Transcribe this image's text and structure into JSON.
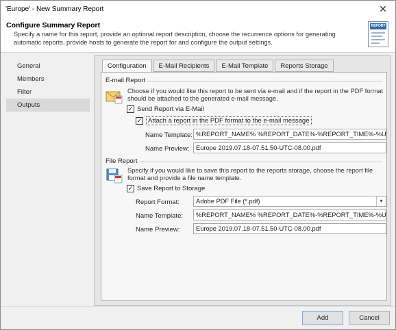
{
  "window": {
    "title": "'Europe' - New Summary Report",
    "close_glyph": "✕"
  },
  "header": {
    "title": "Configure Summary Report",
    "description": "Specify a name for this report, provide an optional report description, choose the recurrence options for generating automatic reports, provide hosts to generate the report for and configure the output settings.",
    "icon_label": "REPORT"
  },
  "nav": {
    "items": [
      "General",
      "Members",
      "Filter",
      "Outputs"
    ],
    "selected": "Outputs"
  },
  "tabs": [
    "Configuration",
    "E-Mail Recipients",
    "E-Mail Template",
    "Reports Storage"
  ],
  "email": {
    "section": "E-mail Report",
    "hint": "Choose if you would like this report to be sent via e-mail and if the report in the PDF format should be attached to the generated e-mail message.",
    "send_label": "Send Report via E-Mail",
    "attach_label": "Attach a report in the PDF format to the e-mail message",
    "name_template_label": "Name Template:",
    "name_template_value": "%REPORT_NAME% %REPORT_DATE%-%REPORT_TIME%-%UTC_O",
    "name_preview_label": "Name Preview:",
    "name_preview_value": "Europe 2019.07.18-07.51.50-UTC-08.00.pdf"
  },
  "file": {
    "section": "File Report",
    "hint": "Specify if you would like to save this report to the reports storage, choose the report file format and provide a file name template.",
    "save_label": "Save Report to Storage",
    "format_label": "Report Format:",
    "format_value": "Adobe PDF File (*.pdf)",
    "name_template_label": "Name Template:",
    "name_template_value": "%REPORT_NAME% %REPORT_DATE%-%REPORT_TIME%-%UTC_O",
    "name_preview_label": "Name Preview:",
    "name_preview_value": "Europe 2019.07.18-07.51.50-UTC-08.00.pdf"
  },
  "checkmark": "✓",
  "footer": {
    "add_label": "Add",
    "cancel_label": "Cancel"
  }
}
